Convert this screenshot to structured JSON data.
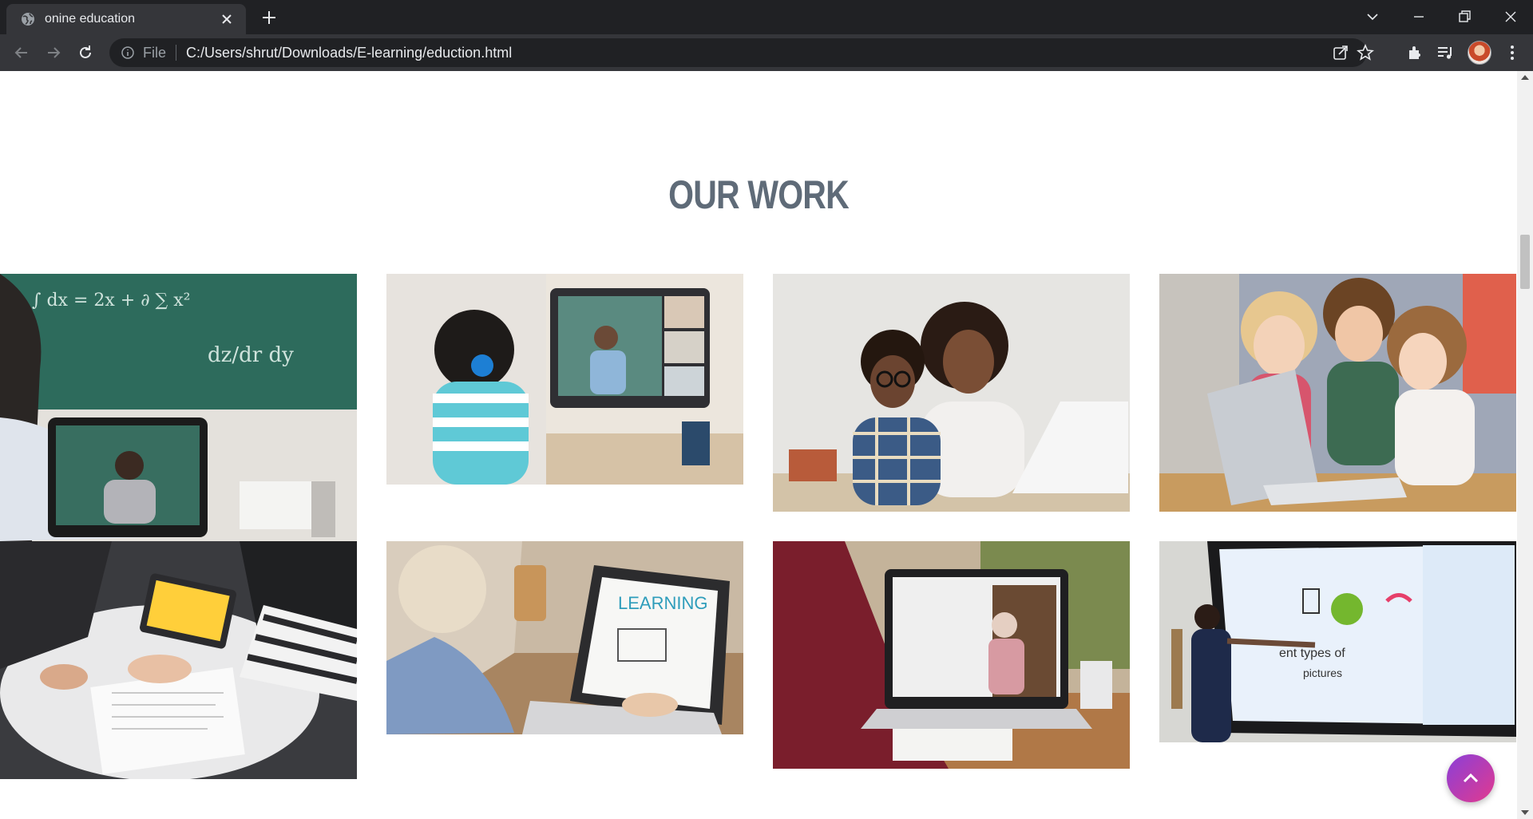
{
  "browser": {
    "tab_title": "onine education",
    "omnibox_scheme": "File",
    "url": "C:/Users/shrut/Downloads/E-learning/eduction.html"
  },
  "page": {
    "section_title": "OUR WORK"
  },
  "colors": {
    "title": "#5f6b78",
    "scroll_button_gradient_start": "#8a3fd8",
    "scroll_button_gradient_end": "#e23a8e"
  }
}
